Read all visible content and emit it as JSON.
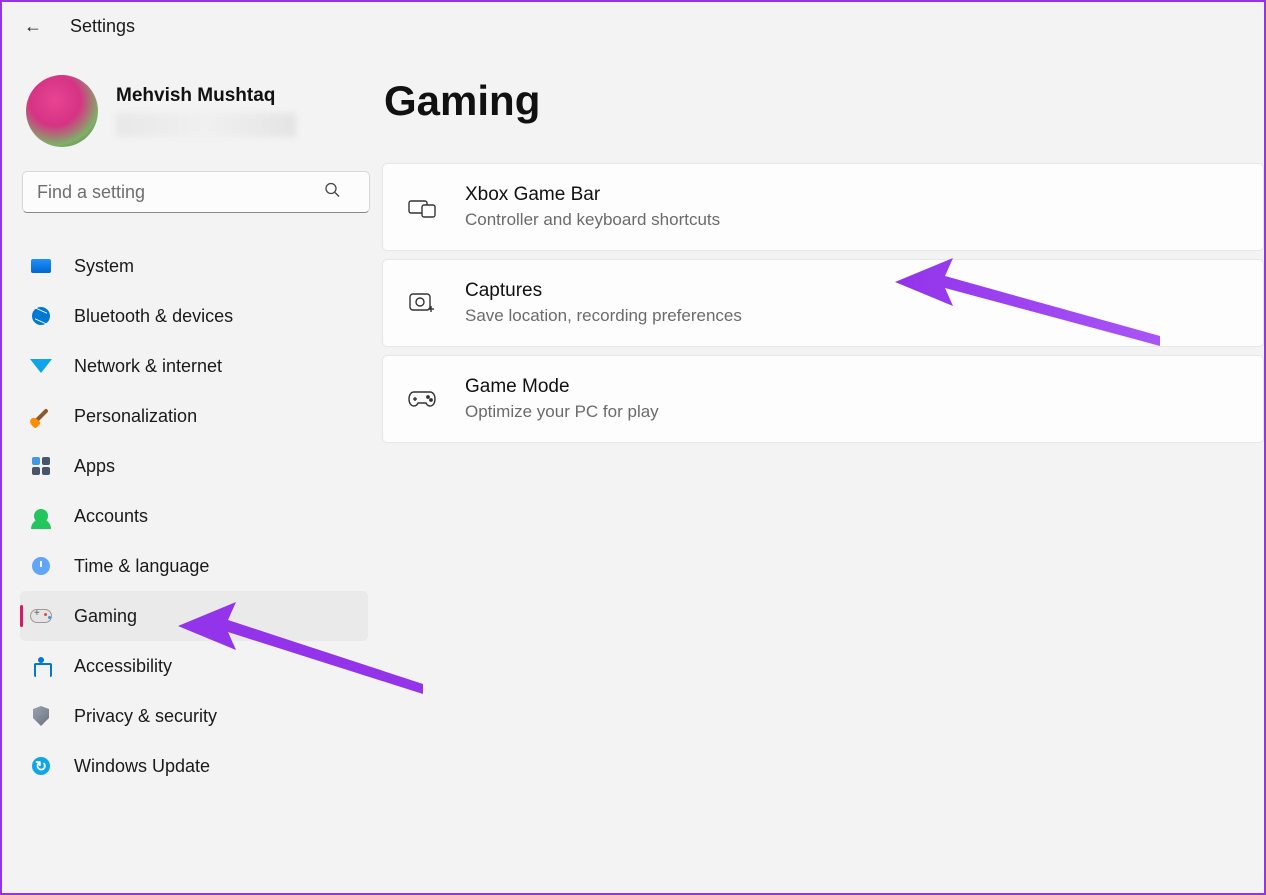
{
  "header": {
    "app_title": "Settings"
  },
  "user": {
    "name": "Mehvish Mushtaq"
  },
  "search": {
    "placeholder": "Find a setting"
  },
  "sidebar": {
    "items": [
      {
        "id": "system",
        "label": "System"
      },
      {
        "id": "bluetooth",
        "label": "Bluetooth & devices"
      },
      {
        "id": "network",
        "label": "Network & internet"
      },
      {
        "id": "personalization",
        "label": "Personalization"
      },
      {
        "id": "apps",
        "label": "Apps"
      },
      {
        "id": "accounts",
        "label": "Accounts"
      },
      {
        "id": "time",
        "label": "Time & language"
      },
      {
        "id": "gaming",
        "label": "Gaming",
        "active": true
      },
      {
        "id": "accessibility",
        "label": "Accessibility"
      },
      {
        "id": "privacy",
        "label": "Privacy & security"
      },
      {
        "id": "update",
        "label": "Windows Update"
      }
    ]
  },
  "main": {
    "title": "Gaming",
    "cards": [
      {
        "id": "xbox-game-bar",
        "title": "Xbox Game Bar",
        "sub": "Controller and keyboard shortcuts"
      },
      {
        "id": "captures",
        "title": "Captures",
        "sub": "Save location, recording preferences"
      },
      {
        "id": "game-mode",
        "title": "Game Mode",
        "sub": "Optimize your PC for play"
      }
    ]
  },
  "annotations": {
    "arrow1_target": "captures",
    "arrow2_target": "gaming-sidebar"
  }
}
